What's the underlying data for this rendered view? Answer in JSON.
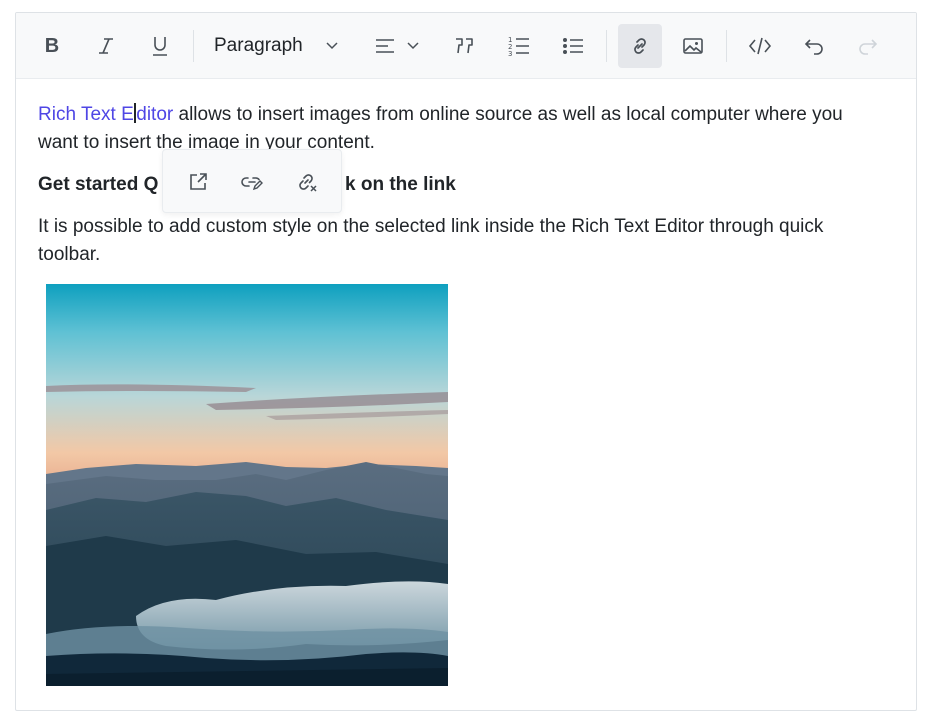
{
  "toolbar": {
    "bold_label": "B",
    "format_label": "Paragraph"
  },
  "content": {
    "p1_link_text_a": "Rich Text E",
    "p1_link_text_b": "ditor",
    "p1_rest_line1": " allows to insert images from online source as well as local computer where you",
    "p1_line2": "want to insert the image in your content.",
    "heading_visible_a": "Get started Q",
    "heading_visible_b": "k on the link",
    "p2_line1": "It is possible to add custom style on the selected link inside the Rich Text Editor through quick",
    "p2_line2": "toolbar."
  },
  "image": {
    "description_icon": "landscape-photo",
    "colors": {
      "sky_top": "#1ea3c0",
      "sky_mid": "#f3c9a8",
      "mountain": "#2d4c5c",
      "cloud": "#c8d9e0"
    }
  },
  "colors": {
    "accent": "#4f46e5",
    "toolbar_bg": "#f8f9fa",
    "active_bg": "#e5e7eb",
    "border": "#dee2e6"
  }
}
